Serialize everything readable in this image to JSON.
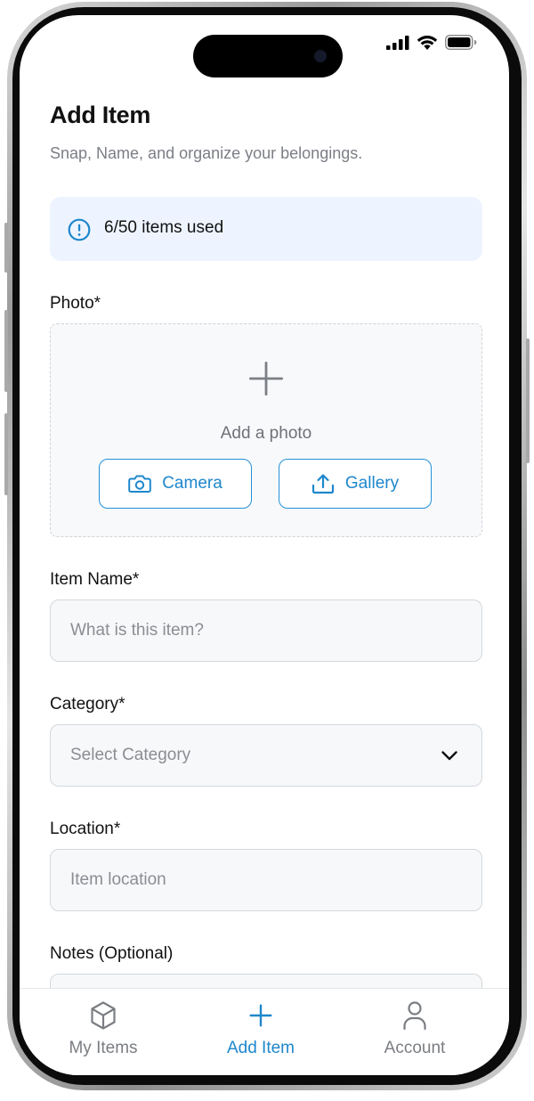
{
  "status_bar": {
    "icons": [
      "signal-icon",
      "wifi-icon",
      "battery-icon"
    ]
  },
  "header": {
    "title": "Add Item",
    "subtitle": "Snap, Name, and organize your belongings."
  },
  "usage_banner": {
    "icon": "info-icon",
    "text": "6/50 items used",
    "used": 6,
    "limit": 50
  },
  "photo": {
    "label": "Photo*",
    "hint": "Add a photo",
    "camera_label": "Camera",
    "gallery_label": "Gallery"
  },
  "item_name": {
    "label": "Item Name*",
    "placeholder": "What is this item?"
  },
  "category": {
    "label": "Category*",
    "placeholder": "Select Category"
  },
  "location": {
    "label": "Location*",
    "placeholder": "Item location"
  },
  "notes": {
    "label": "Notes (Optional)"
  },
  "tabbar": {
    "active": "add_item",
    "tabs": [
      {
        "id": "my_items",
        "label": "My Items",
        "icon": "cube-icon"
      },
      {
        "id": "add_item",
        "label": "Add Item",
        "icon": "plus-icon"
      },
      {
        "id": "account",
        "label": "Account",
        "icon": "person-icon"
      }
    ]
  },
  "colors": {
    "accent": "#1e87cc",
    "banner_bg": "#eef4ff",
    "text_primary": "#111111",
    "text_secondary": "#7b7e85",
    "tab_inactive": "#7a7d82"
  }
}
